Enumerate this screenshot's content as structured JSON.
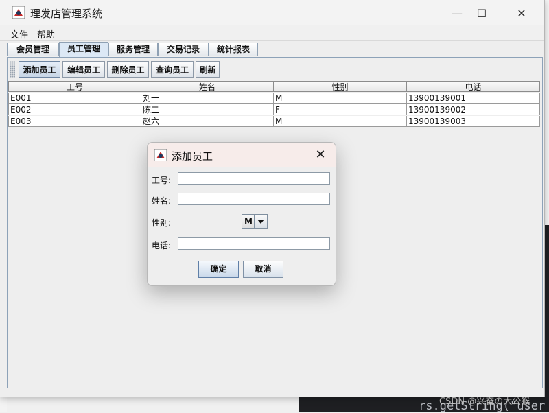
{
  "window": {
    "title": "理发店管理系统",
    "controls": {
      "minimize": "—",
      "maximize": "☐",
      "close": "✕"
    }
  },
  "menubar": {
    "items": [
      "文件",
      "帮助"
    ]
  },
  "tabs": [
    {
      "label": "会员管理"
    },
    {
      "label": "员工管理",
      "active": true
    },
    {
      "label": "服务管理"
    },
    {
      "label": "交易记录"
    },
    {
      "label": "统计报表"
    }
  ],
  "toolbar": {
    "buttons": [
      "添加员工",
      "编辑员工",
      "删除员工",
      "查询员工",
      "刷新"
    ]
  },
  "table": {
    "columns": [
      "工号",
      "姓名",
      "性别",
      "电话"
    ],
    "rows": [
      [
        "E001",
        "刘一",
        "M",
        "13900139001"
      ],
      [
        "E002",
        "陈二",
        "F",
        "13900139002"
      ],
      [
        "E003",
        "赵六",
        "M",
        "13900139003"
      ]
    ]
  },
  "dialog": {
    "title": "添加员工",
    "close": "✕",
    "fields": {
      "id_label": "工号:",
      "id_value": "",
      "name_label": "姓名:",
      "name_value": "",
      "gender_label": "性别:",
      "gender_value": "M",
      "phone_label": "电话:",
      "phone_value": ""
    },
    "ok": "确定",
    "cancel": "取消"
  },
  "background": {
    "code_tail": "rs.getString(\"user",
    "watermark": "CSDN @兴奋の大公猴"
  }
}
